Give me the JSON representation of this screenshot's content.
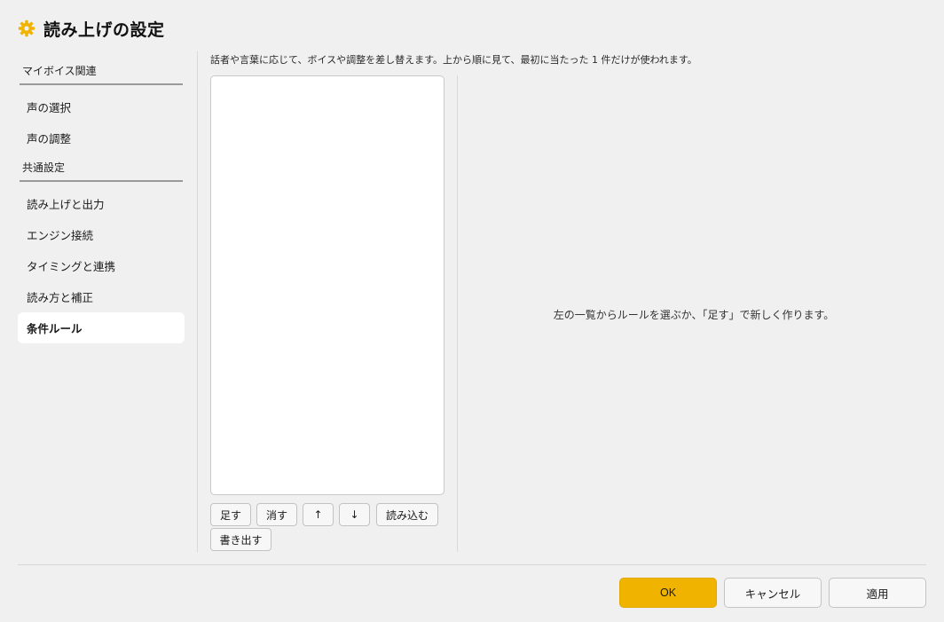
{
  "window": {
    "title": "読み上げの設定",
    "icon": "gear-icon",
    "accent_color": "#f0b400"
  },
  "sidebar": {
    "groups": [
      {
        "header": "マイボイス関連",
        "items": [
          {
            "label": "声の選択"
          },
          {
            "label": "声の調整"
          }
        ]
      },
      {
        "header": "共通設定",
        "items": [
          {
            "label": "読み上げと出力"
          },
          {
            "label": "エンジン接続"
          },
          {
            "label": "タイミングと連携"
          },
          {
            "label": "読み方と補正"
          },
          {
            "label": "条件ルール",
            "active": true
          }
        ]
      }
    ]
  },
  "main": {
    "description": "話者や言葉に応じて、ボイスや調整を差し替えます。上から順に見て、最初に当たった 1 件だけが使われます。",
    "rules": [],
    "buttons": {
      "add": "足す",
      "delete": "消す",
      "up": "↑",
      "down": "↓",
      "import": "読み込む",
      "export": "書き出す"
    },
    "empty_message": "左の一覧からルールを選ぶか、「足す」で新しく作ります。"
  },
  "footer": {
    "ok": "OK",
    "cancel": "キャンセル",
    "apply": "適用"
  }
}
